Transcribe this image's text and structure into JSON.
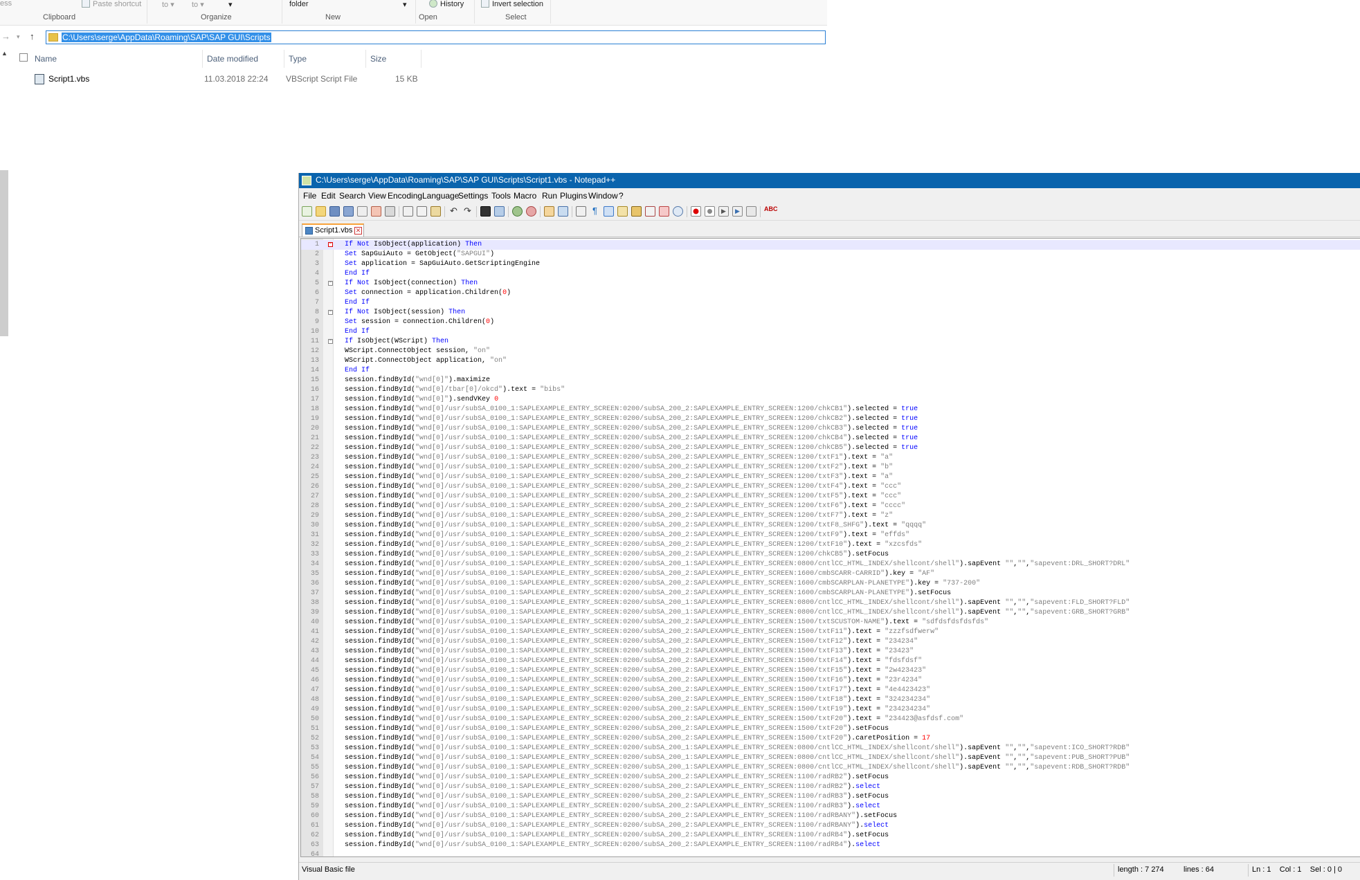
{
  "ribbon": {
    "partial_left": "ess",
    "paste_shortcut": "Paste shortcut",
    "move_to": "to",
    "copy_to": "to",
    "new_folder": "folder",
    "history": "History",
    "invert_selection": "Invert selection",
    "groups": {
      "clipboard": "Clipboard",
      "organize": "Organize",
      "new": "New",
      "open": "Open",
      "select": "Select"
    }
  },
  "address_bar": {
    "path": "C:\\Users\\serge\\AppData\\Roaming\\SAP\\SAP GUI\\Scripts"
  },
  "file_list": {
    "columns": {
      "name": "Name",
      "date": "Date modified",
      "type": "Type",
      "size": "Size"
    },
    "files": [
      {
        "name": "Script1.vbs",
        "date": "11.03.2018 22:24",
        "type": "VBScript Script File",
        "size": "15 KB"
      }
    ]
  },
  "notepad": {
    "title": "C:\\Users\\serge\\AppData\\Roaming\\SAP\\SAP GUI\\Scripts\\Script1.vbs - Notepad++",
    "menu": [
      "File",
      "Edit",
      "Search",
      "View",
      "Encoding",
      "Language",
      "Settings",
      "Tools",
      "Macro",
      "Run",
      "Plugins",
      "Window",
      "?"
    ],
    "tab_label": "Script1.vbs",
    "lines": [
      {
        "n": "1",
        "f": "box",
        "t": "If Not IsObject(application) Then"
      },
      {
        "n": "2",
        "f": "",
        "t": "   Set SapGuiAuto  = GetObject(\"SAPGUI\")"
      },
      {
        "n": "3",
        "f": "",
        "t": "   Set application = SapGuiAuto.GetScriptingEngine"
      },
      {
        "n": "4",
        "f": "end",
        "t": "End If"
      },
      {
        "n": "5",
        "f": "box",
        "t": "If Not IsObject(connection) Then"
      },
      {
        "n": "6",
        "f": "",
        "t": "   Set connection = application.Children(0)"
      },
      {
        "n": "7",
        "f": "end",
        "t": "End If"
      },
      {
        "n": "8",
        "f": "box",
        "t": "If Not IsObject(session) Then"
      },
      {
        "n": "9",
        "f": "",
        "t": "   Set session    = connection.Children(0)"
      },
      {
        "n": "10",
        "f": "end",
        "t": "End If"
      },
      {
        "n": "11",
        "f": "box",
        "t": "If IsObject(WScript) Then"
      },
      {
        "n": "12",
        "f": "",
        "t": "   WScript.ConnectObject session,     \"on\""
      },
      {
        "n": "13",
        "f": "",
        "t": "   WScript.ConnectObject application, \"on\""
      },
      {
        "n": "14",
        "f": "end",
        "t": "End If"
      },
      {
        "n": "15",
        "f": "",
        "t": "session.findById(\"wnd[0]\").maximize"
      },
      {
        "n": "16",
        "f": "",
        "t": "session.findById(\"wnd[0]/tbar[0]/okcd\").text = \"bibs\""
      },
      {
        "n": "17",
        "f": "",
        "t": "session.findById(\"wnd[0]\").sendVKey 0"
      },
      {
        "n": "18",
        "f": "",
        "t": "session.findById(\"wnd[0]/usr/subSA_0100_1:SAPLEXAMPLE_ENTRY_SCREEN:0200/subSA_200_2:SAPLEXAMPLE_ENTRY_SCREEN:1200/chkCB1\").selected = true"
      },
      {
        "n": "19",
        "f": "",
        "t": "session.findById(\"wnd[0]/usr/subSA_0100_1:SAPLEXAMPLE_ENTRY_SCREEN:0200/subSA_200_2:SAPLEXAMPLE_ENTRY_SCREEN:1200/chkCB2\").selected = true"
      },
      {
        "n": "20",
        "f": "",
        "t": "session.findById(\"wnd[0]/usr/subSA_0100_1:SAPLEXAMPLE_ENTRY_SCREEN:0200/subSA_200_2:SAPLEXAMPLE_ENTRY_SCREEN:1200/chkCB3\").selected = true"
      },
      {
        "n": "21",
        "f": "",
        "t": "session.findById(\"wnd[0]/usr/subSA_0100_1:SAPLEXAMPLE_ENTRY_SCREEN:0200/subSA_200_2:SAPLEXAMPLE_ENTRY_SCREEN:1200/chkCB4\").selected = true"
      },
      {
        "n": "22",
        "f": "",
        "t": "session.findById(\"wnd[0]/usr/subSA_0100_1:SAPLEXAMPLE_ENTRY_SCREEN:0200/subSA_200_2:SAPLEXAMPLE_ENTRY_SCREEN:1200/chkCB5\").selected = true"
      },
      {
        "n": "23",
        "f": "",
        "t": "session.findById(\"wnd[0]/usr/subSA_0100_1:SAPLEXAMPLE_ENTRY_SCREEN:0200/subSA_200_2:SAPLEXAMPLE_ENTRY_SCREEN:1200/txtF1\").text = \"a\""
      },
      {
        "n": "24",
        "f": "",
        "t": "session.findById(\"wnd[0]/usr/subSA_0100_1:SAPLEXAMPLE_ENTRY_SCREEN:0200/subSA_200_2:SAPLEXAMPLE_ENTRY_SCREEN:1200/txtF2\").text = \"b\""
      },
      {
        "n": "25",
        "f": "",
        "t": "session.findById(\"wnd[0]/usr/subSA_0100_1:SAPLEXAMPLE_ENTRY_SCREEN:0200/subSA_200_2:SAPLEXAMPLE_ENTRY_SCREEN:1200/txtF3\").text = \"a\""
      },
      {
        "n": "26",
        "f": "",
        "t": "session.findById(\"wnd[0]/usr/subSA_0100_1:SAPLEXAMPLE_ENTRY_SCREEN:0200/subSA_200_2:SAPLEXAMPLE_ENTRY_SCREEN:1200/txtF4\").text = \"ccc\""
      },
      {
        "n": "27",
        "f": "",
        "t": "session.findById(\"wnd[0]/usr/subSA_0100_1:SAPLEXAMPLE_ENTRY_SCREEN:0200/subSA_200_2:SAPLEXAMPLE_ENTRY_SCREEN:1200/txtF5\").text = \"ccc\""
      },
      {
        "n": "28",
        "f": "",
        "t": "session.findById(\"wnd[0]/usr/subSA_0100_1:SAPLEXAMPLE_ENTRY_SCREEN:0200/subSA_200_2:SAPLEXAMPLE_ENTRY_SCREEN:1200/txtF6\").text = \"cccc\""
      },
      {
        "n": "29",
        "f": "",
        "t": "session.findById(\"wnd[0]/usr/subSA_0100_1:SAPLEXAMPLE_ENTRY_SCREEN:0200/subSA_200_2:SAPLEXAMPLE_ENTRY_SCREEN:1200/txtF7\").text = \"z\""
      },
      {
        "n": "30",
        "f": "",
        "t": "session.findById(\"wnd[0]/usr/subSA_0100_1:SAPLEXAMPLE_ENTRY_SCREEN:0200/subSA_200_2:SAPLEXAMPLE_ENTRY_SCREEN:1200/txtF8_SHFG\").text = \"qqqq\""
      },
      {
        "n": "31",
        "f": "",
        "t": "session.findById(\"wnd[0]/usr/subSA_0100_1:SAPLEXAMPLE_ENTRY_SCREEN:0200/subSA_200_2:SAPLEXAMPLE_ENTRY_SCREEN:1200/txtF9\").text = \"effds\""
      },
      {
        "n": "32",
        "f": "",
        "t": "session.findById(\"wnd[0]/usr/subSA_0100_1:SAPLEXAMPLE_ENTRY_SCREEN:0200/subSA_200_2:SAPLEXAMPLE_ENTRY_SCREEN:1200/txtF10\").text = \"xzcsfds\""
      },
      {
        "n": "33",
        "f": "",
        "t": "session.findById(\"wnd[0]/usr/subSA_0100_1:SAPLEXAMPLE_ENTRY_SCREEN:0200/subSA_200_2:SAPLEXAMPLE_ENTRY_SCREEN:1200/chkCB5\").setFocus"
      },
      {
        "n": "34",
        "f": "",
        "t": "session.findById(\"wnd[0]/usr/subSA_0100_1:SAPLEXAMPLE_ENTRY_SCREEN:0200/subSA_200_1:SAPLEXAMPLE_ENTRY_SCREEN:0800/cntlCC_HTML_INDEX/shellcont/shell\").sapEvent \"\",\"\",\"sapevent:DRL_SHORT?DRL\""
      },
      {
        "n": "35",
        "f": "",
        "t": "session.findById(\"wnd[0]/usr/subSA_0100_1:SAPLEXAMPLE_ENTRY_SCREEN:0200/subSA_200_2:SAPLEXAMPLE_ENTRY_SCREEN:1600/cmbSCARR-CARRID\").key = \"AF\""
      },
      {
        "n": "36",
        "f": "",
        "t": "session.findById(\"wnd[0]/usr/subSA_0100_1:SAPLEXAMPLE_ENTRY_SCREEN:0200/subSA_200_2:SAPLEXAMPLE_ENTRY_SCREEN:1600/cmbSCARPLAN-PLANETYPE\").key = \"737-200\""
      },
      {
        "n": "37",
        "f": "",
        "t": "session.findById(\"wnd[0]/usr/subSA_0100_1:SAPLEXAMPLE_ENTRY_SCREEN:0200/subSA_200_2:SAPLEXAMPLE_ENTRY_SCREEN:1600/cmbSCARPLAN-PLANETYPE\").setFocus"
      },
      {
        "n": "38",
        "f": "",
        "t": "session.findById(\"wnd[0]/usr/subSA_0100_1:SAPLEXAMPLE_ENTRY_SCREEN:0200/subSA_200_1:SAPLEXAMPLE_ENTRY_SCREEN:0800/cntlCC_HTML_INDEX/shellcont/shell\").sapEvent \"\",\"\",\"sapevent:FLD_SHORT?FLD\""
      },
      {
        "n": "39",
        "f": "",
        "t": "session.findById(\"wnd[0]/usr/subSA_0100_1:SAPLEXAMPLE_ENTRY_SCREEN:0200/subSA_200_1:SAPLEXAMPLE_ENTRY_SCREEN:0800/cntlCC_HTML_INDEX/shellcont/shell\").sapEvent \"\",\"\",\"sapevent:GRB_SHORT?GRB\""
      },
      {
        "n": "40",
        "f": "",
        "t": "session.findById(\"wnd[0]/usr/subSA_0100_1:SAPLEXAMPLE_ENTRY_SCREEN:0200/subSA_200_2:SAPLEXAMPLE_ENTRY_SCREEN:1500/txtSCUSTOM-NAME\").text = \"sdfdsfdsfdsfds\""
      },
      {
        "n": "41",
        "f": "",
        "t": "session.findById(\"wnd[0]/usr/subSA_0100_1:SAPLEXAMPLE_ENTRY_SCREEN:0200/subSA_200_2:SAPLEXAMPLE_ENTRY_SCREEN:1500/txtF11\").text = \"zzzfsdfwerw\""
      },
      {
        "n": "42",
        "f": "",
        "t": "session.findById(\"wnd[0]/usr/subSA_0100_1:SAPLEXAMPLE_ENTRY_SCREEN:0200/subSA_200_2:SAPLEXAMPLE_ENTRY_SCREEN:1500/txtF12\").text = \"234234\""
      },
      {
        "n": "43",
        "f": "",
        "t": "session.findById(\"wnd[0]/usr/subSA_0100_1:SAPLEXAMPLE_ENTRY_SCREEN:0200/subSA_200_2:SAPLEXAMPLE_ENTRY_SCREEN:1500/txtF13\").text = \"23423\""
      },
      {
        "n": "44",
        "f": "",
        "t": "session.findById(\"wnd[0]/usr/subSA_0100_1:SAPLEXAMPLE_ENTRY_SCREEN:0200/subSA_200_2:SAPLEXAMPLE_ENTRY_SCREEN:1500/txtF14\").text = \"fdsfdsf\""
      },
      {
        "n": "45",
        "f": "",
        "t": "session.findById(\"wnd[0]/usr/subSA_0100_1:SAPLEXAMPLE_ENTRY_SCREEN:0200/subSA_200_2:SAPLEXAMPLE_ENTRY_SCREEN:1500/txtF15\").text = \"2w423423\""
      },
      {
        "n": "46",
        "f": "",
        "t": "session.findById(\"wnd[0]/usr/subSA_0100_1:SAPLEXAMPLE_ENTRY_SCREEN:0200/subSA_200_2:SAPLEXAMPLE_ENTRY_SCREEN:1500/txtF16\").text = \"23r4234\""
      },
      {
        "n": "47",
        "f": "",
        "t": "session.findById(\"wnd[0]/usr/subSA_0100_1:SAPLEXAMPLE_ENTRY_SCREEN:0200/subSA_200_2:SAPLEXAMPLE_ENTRY_SCREEN:1500/txtF17\").text = \"4e4423423\""
      },
      {
        "n": "48",
        "f": "",
        "t": "session.findById(\"wnd[0]/usr/subSA_0100_1:SAPLEXAMPLE_ENTRY_SCREEN:0200/subSA_200_2:SAPLEXAMPLE_ENTRY_SCREEN:1500/txtF18\").text = \"324234234\""
      },
      {
        "n": "49",
        "f": "",
        "t": "session.findById(\"wnd[0]/usr/subSA_0100_1:SAPLEXAMPLE_ENTRY_SCREEN:0200/subSA_200_2:SAPLEXAMPLE_ENTRY_SCREEN:1500/txtF19\").text = \"234234234\""
      },
      {
        "n": "50",
        "f": "",
        "t": "session.findById(\"wnd[0]/usr/subSA_0100_1:SAPLEXAMPLE_ENTRY_SCREEN:0200/subSA_200_2:SAPLEXAMPLE_ENTRY_SCREEN:1500/txtF20\").text = \"234423@asfdsf.com\""
      },
      {
        "n": "51",
        "f": "",
        "t": "session.findById(\"wnd[0]/usr/subSA_0100_1:SAPLEXAMPLE_ENTRY_SCREEN:0200/subSA_200_2:SAPLEXAMPLE_ENTRY_SCREEN:1500/txtF20\").setFocus"
      },
      {
        "n": "52",
        "f": "",
        "t": "session.findById(\"wnd[0]/usr/subSA_0100_1:SAPLEXAMPLE_ENTRY_SCREEN:0200/subSA_200_2:SAPLEXAMPLE_ENTRY_SCREEN:1500/txtF20\").caretPosition = 17"
      },
      {
        "n": "53",
        "f": "",
        "t": "session.findById(\"wnd[0]/usr/subSA_0100_1:SAPLEXAMPLE_ENTRY_SCREEN:0200/subSA_200_1:SAPLEXAMPLE_ENTRY_SCREEN:0800/cntlCC_HTML_INDEX/shellcont/shell\").sapEvent \"\",\"\",\"sapevent:ICO_SHORT?RDB\""
      },
      {
        "n": "54",
        "f": "",
        "t": "session.findById(\"wnd[0]/usr/subSA_0100_1:SAPLEXAMPLE_ENTRY_SCREEN:0200/subSA_200_1:SAPLEXAMPLE_ENTRY_SCREEN:0800/cntlCC_HTML_INDEX/shellcont/shell\").sapEvent \"\",\"\",\"sapevent:PUB_SHORT?PUB\""
      },
      {
        "n": "55",
        "f": "",
        "t": "session.findById(\"wnd[0]/usr/subSA_0100_1:SAPLEXAMPLE_ENTRY_SCREEN:0200/subSA_200_1:SAPLEXAMPLE_ENTRY_SCREEN:0800/cntlCC_HTML_INDEX/shellcont/shell\").sapEvent \"\",\"\",\"sapevent:RDB_SHORT?RDB\""
      },
      {
        "n": "56",
        "f": "",
        "t": "session.findById(\"wnd[0]/usr/subSA_0100_1:SAPLEXAMPLE_ENTRY_SCREEN:0200/subSA_200_2:SAPLEXAMPLE_ENTRY_SCREEN:1100/radRB2\").setFocus"
      },
      {
        "n": "57",
        "f": "",
        "t": "session.findById(\"wnd[0]/usr/subSA_0100_1:SAPLEXAMPLE_ENTRY_SCREEN:0200/subSA_200_2:SAPLEXAMPLE_ENTRY_SCREEN:1100/radRB2\").select"
      },
      {
        "n": "58",
        "f": "",
        "t": "session.findById(\"wnd[0]/usr/subSA_0100_1:SAPLEXAMPLE_ENTRY_SCREEN:0200/subSA_200_2:SAPLEXAMPLE_ENTRY_SCREEN:1100/radRB3\").setFocus"
      },
      {
        "n": "59",
        "f": "",
        "t": "session.findById(\"wnd[0]/usr/subSA_0100_1:SAPLEXAMPLE_ENTRY_SCREEN:0200/subSA_200_2:SAPLEXAMPLE_ENTRY_SCREEN:1100/radRB3\").select"
      },
      {
        "n": "60",
        "f": "",
        "t": "session.findById(\"wnd[0]/usr/subSA_0100_1:SAPLEXAMPLE_ENTRY_SCREEN:0200/subSA_200_2:SAPLEXAMPLE_ENTRY_SCREEN:1100/radRBANY\").setFocus"
      },
      {
        "n": "61",
        "f": "",
        "t": "session.findById(\"wnd[0]/usr/subSA_0100_1:SAPLEXAMPLE_ENTRY_SCREEN:0200/subSA_200_2:SAPLEXAMPLE_ENTRY_SCREEN:1100/radRBANY\").select"
      },
      {
        "n": "62",
        "f": "",
        "t": "session.findById(\"wnd[0]/usr/subSA_0100_1:SAPLEXAMPLE_ENTRY_SCREEN:0200/subSA_200_2:SAPLEXAMPLE_ENTRY_SCREEN:1100/radRB4\").setFocus"
      },
      {
        "n": "63",
        "f": "",
        "t": "session.findById(\"wnd[0]/usr/subSA_0100_1:SAPLEXAMPLE_ENTRY_SCREEN:0200/subSA_200_2:SAPLEXAMPLE_ENTRY_SCREEN:1100/radRB4\").select"
      },
      {
        "n": "64",
        "f": "",
        "t": ""
      }
    ],
    "status": {
      "file_type": "Visual Basic file",
      "length": "length : 7 274",
      "lines": "lines : 64",
      "position": "Ln : 1    Col : 1    Sel : 0 | 0"
    }
  },
  "colors": {
    "title_bar": "#0a64ad",
    "keyword": "#0000ff",
    "string": "#808080",
    "number": "#ff0000",
    "selection": "#3390e8"
  }
}
